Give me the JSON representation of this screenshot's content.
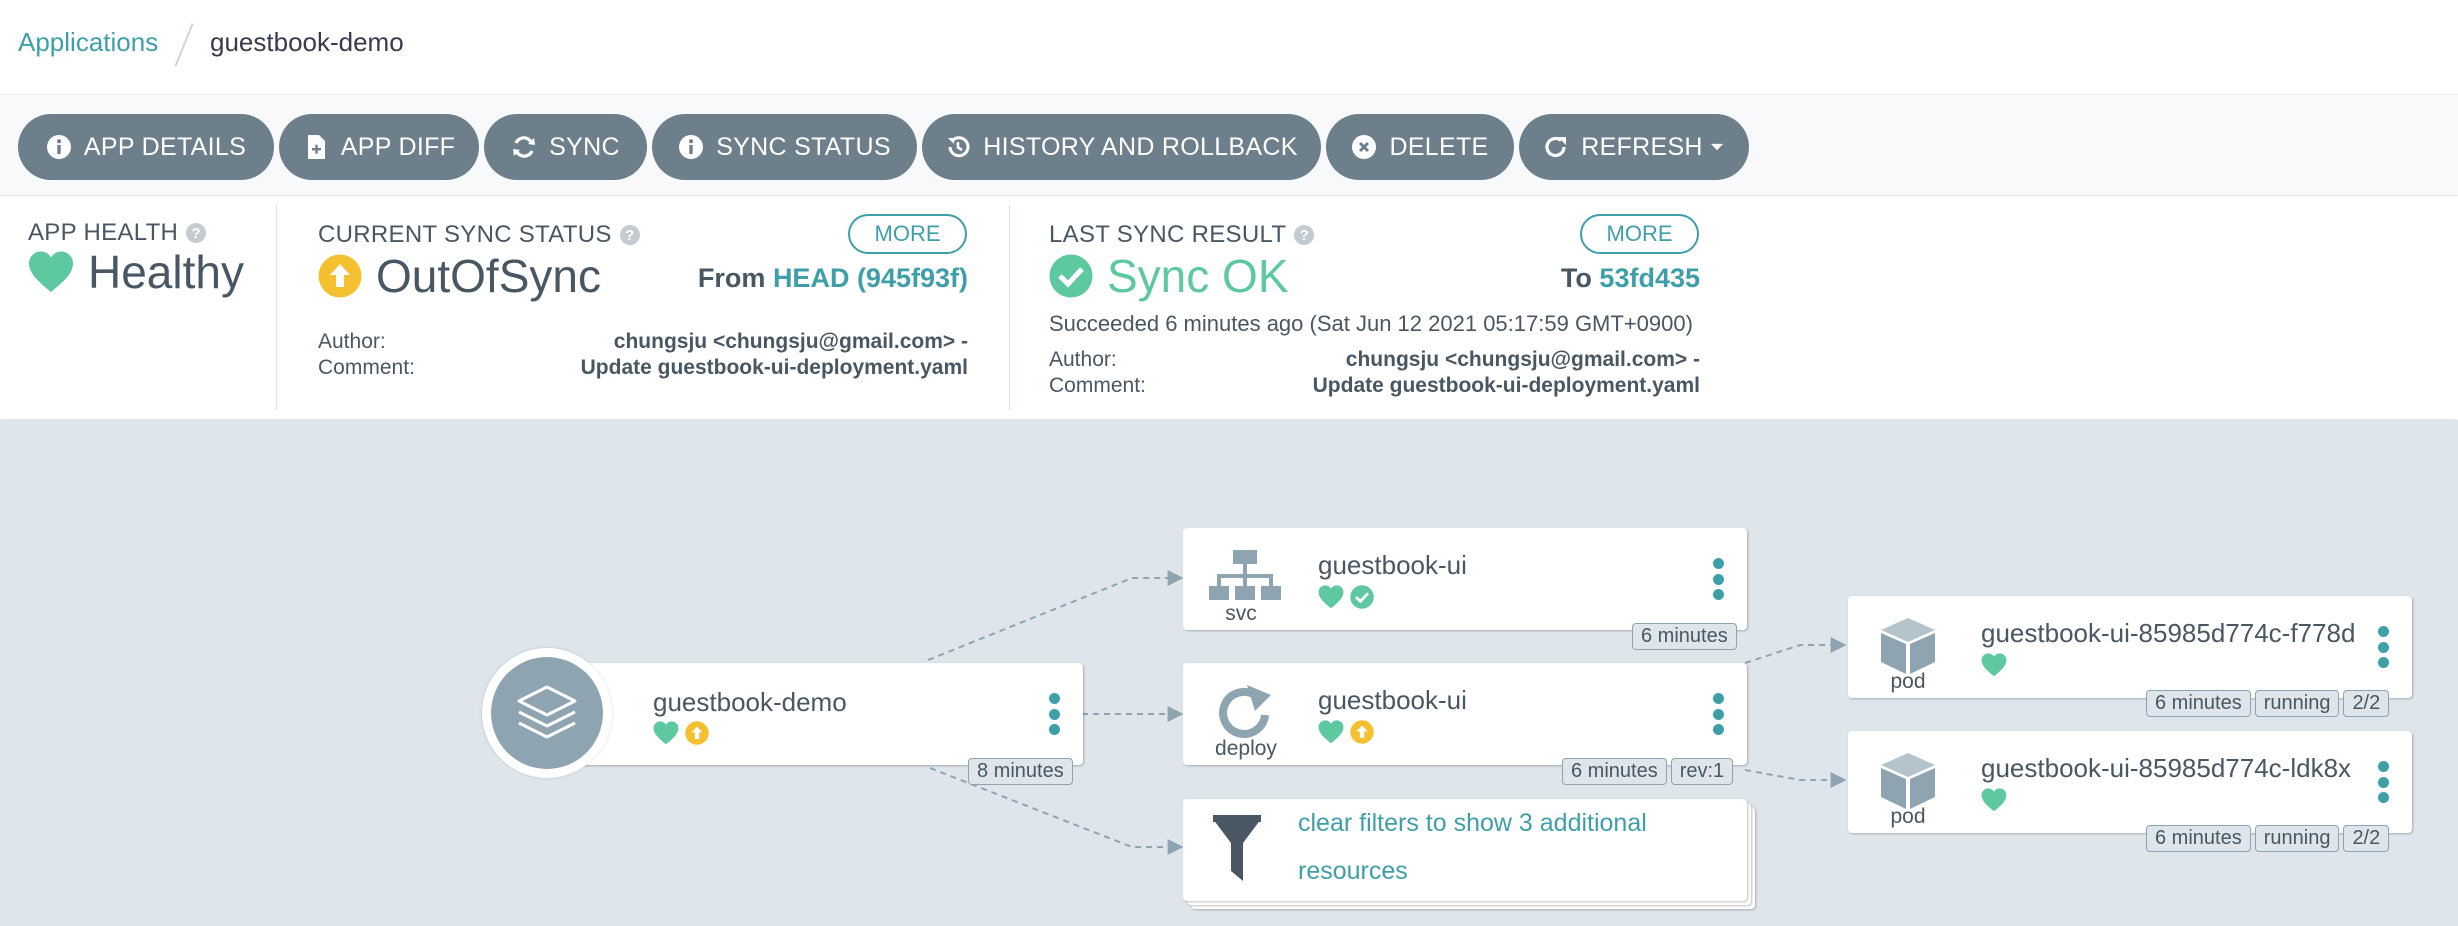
{
  "breadcrumb": {
    "parent": "Applications",
    "current": "guestbook-demo"
  },
  "toolbar": {
    "app_details": "APP DETAILS",
    "app_diff": "APP DIFF",
    "sync": "SYNC",
    "sync_status": "SYNC STATUS",
    "history": "HISTORY AND ROLLBACK",
    "delete": "DELETE",
    "refresh": "REFRESH"
  },
  "health": {
    "title": "APP HEALTH",
    "value": "Healthy"
  },
  "current_sync": {
    "title": "CURRENT SYNC STATUS",
    "value": "OutOfSync",
    "more": "MORE",
    "from_label": "From",
    "revision": "HEAD (945f93f)",
    "author_label": "Author:",
    "author": "chungsju <chungsju@gmail.com> -",
    "comment_label": "Comment:",
    "comment": "Update guestbook-ui-deployment.yaml"
  },
  "last_sync": {
    "title": "LAST SYNC RESULT",
    "value": "Sync OK",
    "more": "MORE",
    "to_label": "To",
    "revision": "53fd435",
    "succeeded": "Succeeded 6 minutes ago (Sat Jun 12 2021 05:17:59 GMT+0900)",
    "author_label": "Author:",
    "author": "chungsju <chungsju@gmail.com> -",
    "comment_label": "Comment:",
    "comment": "Update guestbook-ui-deployment.yaml"
  },
  "tree": {
    "app": {
      "name": "guestbook-demo",
      "age": "8 minutes"
    },
    "svc": {
      "name": "guestbook-ui",
      "kind": "svc",
      "age": "6 minutes"
    },
    "deploy": {
      "name": "guestbook-ui",
      "kind": "deploy",
      "age": "6 minutes",
      "rev": "rev:1"
    },
    "filter": {
      "text_line1": "clear filters to show 3 additional",
      "text_line2": "resources"
    },
    "pod1": {
      "name": "guestbook-ui-85985d774c-f778d",
      "kind": "pod",
      "age": "6 minutes",
      "status": "running",
      "ready": "2/2"
    },
    "pod2": {
      "name": "guestbook-ui-85985d774c-ldk8x",
      "kind": "pod",
      "age": "6 minutes",
      "status": "running",
      "ready": "2/2"
    }
  },
  "colors": {
    "accent": "#3f9fa9",
    "healthy": "#5ec8a0",
    "out_of_sync": "#f4c030",
    "synced": "#5ec8a0",
    "button": "#6d7f8b",
    "canvas": "#dee6eb"
  }
}
